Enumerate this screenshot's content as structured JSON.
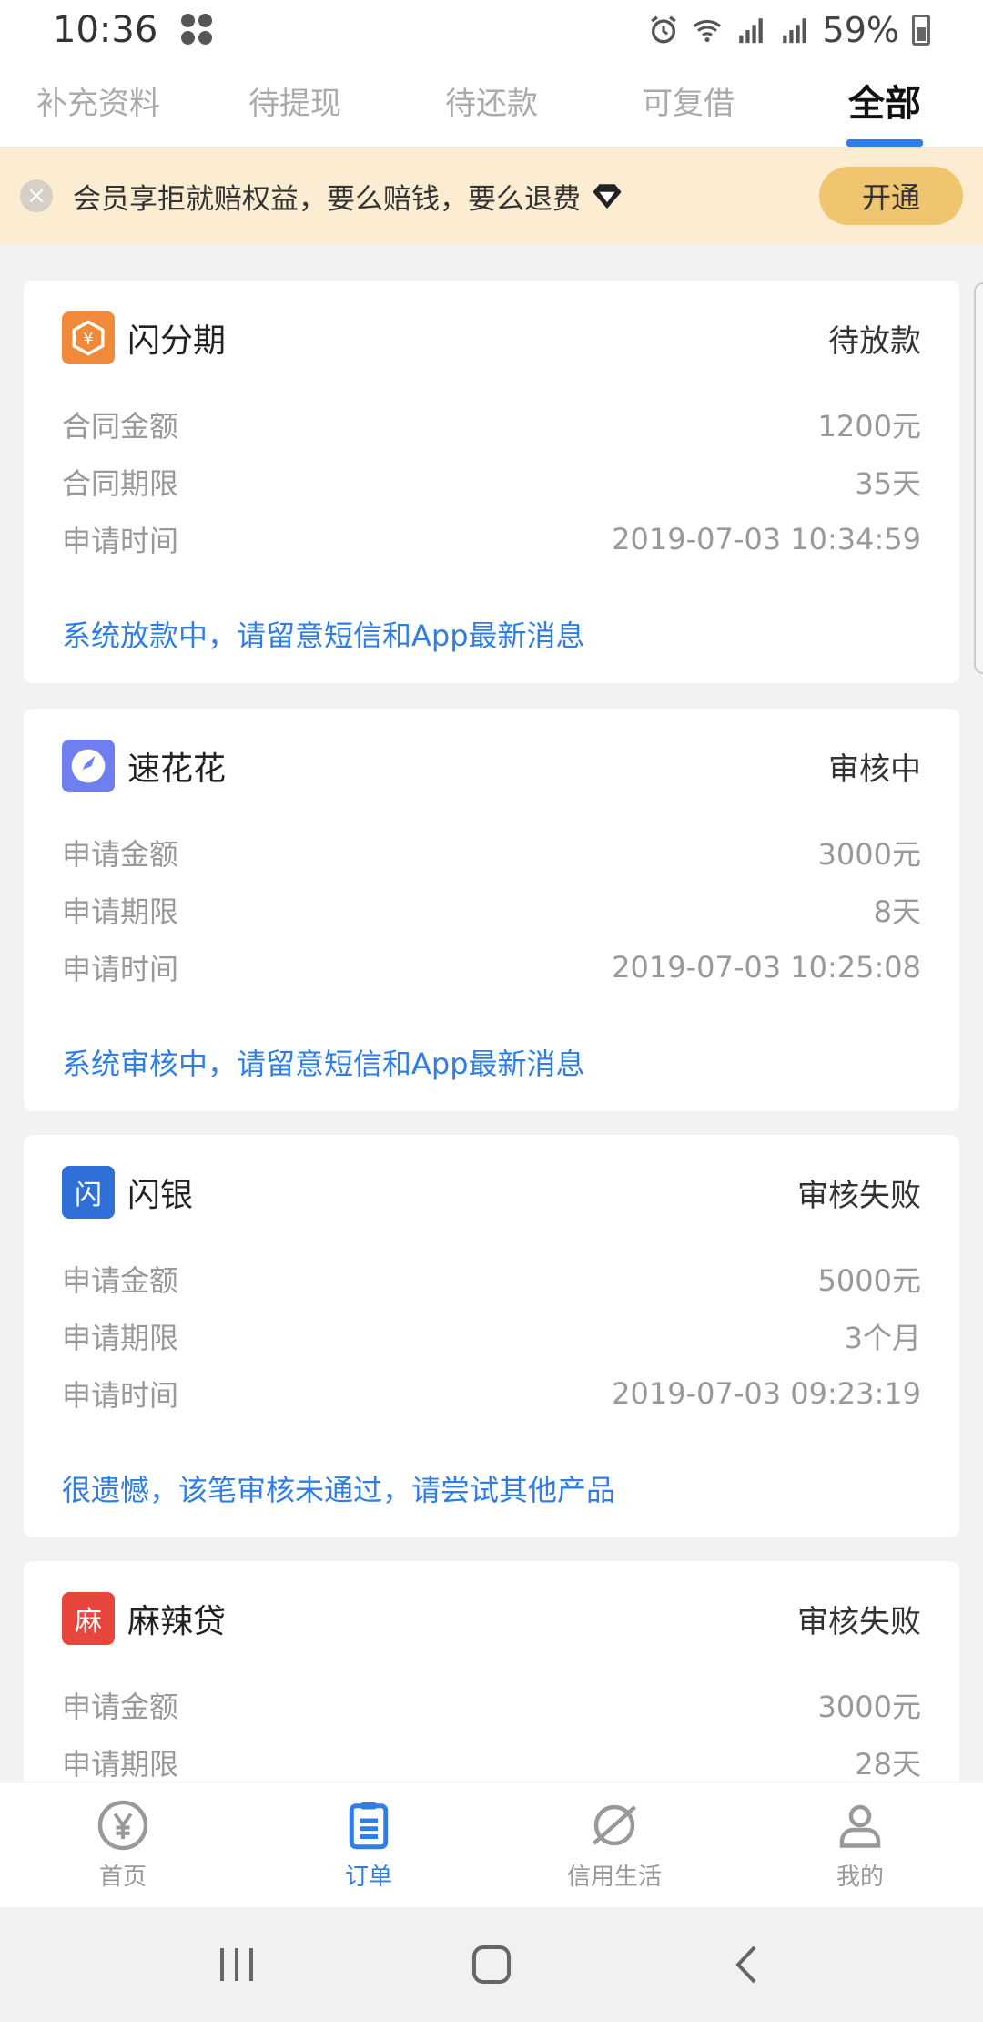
{
  "status_bar": {
    "time": "10:36",
    "battery": "59%"
  },
  "tabs": [
    {
      "label": "补充资料",
      "active": false
    },
    {
      "label": "待提现",
      "active": false
    },
    {
      "label": "待还款",
      "active": false
    },
    {
      "label": "可复借",
      "active": false
    },
    {
      "label": "全部",
      "active": true
    }
  ],
  "banner": {
    "text": "会员享拒就赔权益，要么赔钱，要么退费",
    "button": "开通"
  },
  "orders": [
    {
      "name": "闪分期",
      "status": "待放款",
      "logo_color": "#f08a3a",
      "logo_text": "¥",
      "rows": [
        {
          "label": "合同金额",
          "value": "1200元"
        },
        {
          "label": "合同期限",
          "value": "35天"
        },
        {
          "label": "申请时间",
          "value": "2019-07-03 10:34:59"
        }
      ],
      "note": "系统放款中，请留意短信和App最新消息"
    },
    {
      "name": "速花花",
      "status": "审核中",
      "logo_color": "#6f7ef0",
      "logo_text": "🚀",
      "rows": [
        {
          "label": "申请金额",
          "value": "3000元"
        },
        {
          "label": "申请期限",
          "value": "8天"
        },
        {
          "label": "申请时间",
          "value": "2019-07-03 10:25:08"
        }
      ],
      "note": "系统审核中，请留意短信和App最新消息"
    },
    {
      "name": "闪银",
      "status": "审核失败",
      "logo_color": "#2f6fd8",
      "logo_text": "闪",
      "rows": [
        {
          "label": "申请金额",
          "value": "5000元"
        },
        {
          "label": "申请期限",
          "value": "3个月"
        },
        {
          "label": "申请时间",
          "value": "2019-07-03 09:23:19"
        }
      ],
      "note": "很遗憾，该笔审核未通过，请尝试其他产品"
    },
    {
      "name": "麻辣贷",
      "status": "审核失败",
      "logo_color": "#e8453c",
      "logo_text": "麻",
      "rows": [
        {
          "label": "申请金额",
          "value": "3000元"
        },
        {
          "label": "申请期限",
          "value": "28天"
        }
      ],
      "note": ""
    }
  ],
  "bottom_nav": [
    {
      "label": "首页",
      "icon": "yen-circle-icon",
      "active": false
    },
    {
      "label": "订单",
      "icon": "clipboard-icon",
      "active": true
    },
    {
      "label": "信用生活",
      "icon": "planet-icon",
      "active": false
    },
    {
      "label": "我的",
      "icon": "user-icon",
      "active": false
    }
  ]
}
